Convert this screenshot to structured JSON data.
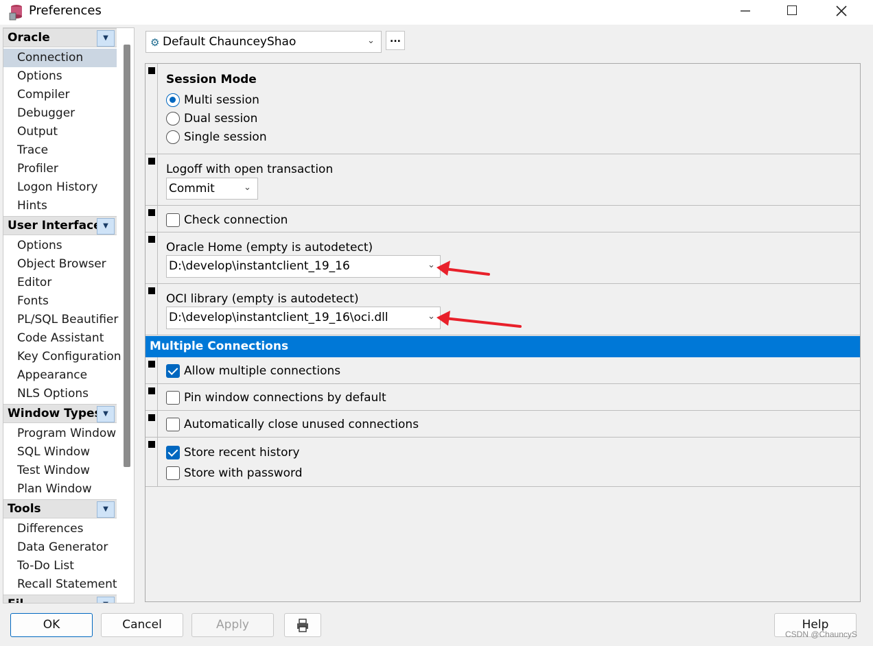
{
  "window": {
    "title": "Preferences"
  },
  "sidebar": {
    "categories": [
      {
        "label": "Oracle",
        "items": [
          "Connection",
          "Options",
          "Compiler",
          "Debugger",
          "Output",
          "Trace",
          "Profiler",
          "Logon History",
          "Hints"
        ]
      },
      {
        "label": "User Interface",
        "items": [
          "Options",
          "Object Browser",
          "Editor",
          "Fonts",
          "PL/SQL Beautifier",
          "Code Assistant",
          "Key Configuration",
          "Appearance",
          "NLS Options"
        ]
      },
      {
        "label": "Window Types",
        "items": [
          "Program Window",
          "SQL Window",
          "Test Window",
          "Plan Window"
        ]
      },
      {
        "label": "Tools",
        "items": [
          "Differences",
          "Data Generator",
          "To-Do List",
          "Recall Statement"
        ]
      },
      {
        "label": "Fil",
        "items": []
      }
    ],
    "selected": "Connection"
  },
  "connection": {
    "selected": "Default ChaunceyShao",
    "more_label": "..."
  },
  "session_mode": {
    "heading": "Session Mode",
    "options": [
      "Multi session",
      "Dual session",
      "Single session"
    ],
    "selected": "Multi session"
  },
  "logoff": {
    "label": "Logoff with open transaction",
    "value": "Commit"
  },
  "check_connection": {
    "label": "Check connection",
    "checked": false
  },
  "oracle_home": {
    "label": "Oracle Home (empty is autodetect)",
    "value": "D:\\develop\\instantclient_19_16"
  },
  "oci_library": {
    "label": "OCI library (empty is autodetect)",
    "value": "D:\\develop\\instantclient_19_16\\oci.dll"
  },
  "multiple_connections": {
    "header": "Multiple Connections",
    "allow_multiple": {
      "label": "Allow multiple connections",
      "checked": true
    },
    "pin_window": {
      "label": "Pin window connections by default",
      "checked": false
    },
    "auto_close": {
      "label": "Automatically close unused connections",
      "checked": false
    },
    "store_history": {
      "label": "Store recent history",
      "checked": true
    },
    "store_password": {
      "label": "Store with password",
      "checked": false
    }
  },
  "footer": {
    "ok": "OK",
    "cancel": "Cancel",
    "apply": "Apply",
    "help": "Help"
  },
  "watermark": "CSDN @ChauncyS",
  "colors": {
    "accent": "#0078d7",
    "arrow": "#e8202a"
  }
}
